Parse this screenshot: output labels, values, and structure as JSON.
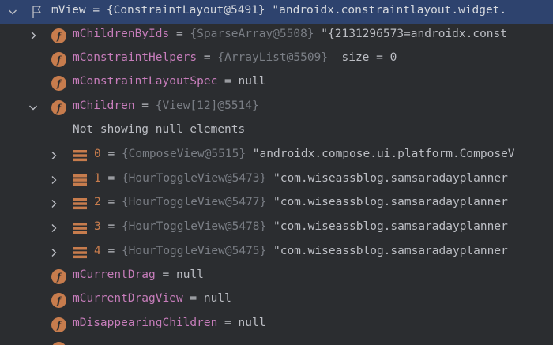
{
  "rows": [
    {
      "name": "mView",
      "eq": " = ",
      "ref": "{ConstraintLayout@5491}",
      "rest": " \"androidx.constraintlayout.widget."
    },
    {
      "name": "mChildrenByIds",
      "eq": " = ",
      "ref": "{SparseArray@5508}",
      "rest": " \"{2131296573=androidx.const"
    },
    {
      "name": "mConstraintHelpers",
      "eq": " = ",
      "ref": "{ArrayList@5509}",
      "rest": "  size = 0"
    },
    {
      "name": "mConstraintLayoutSpec",
      "eq": " = ",
      "rest": "null"
    },
    {
      "name": "mChildren",
      "eq": " = ",
      "ref": "{View[12]@5514}"
    },
    {
      "note": "Not showing null elements"
    },
    {
      "name": "0",
      "eq": " = ",
      "ref": "{ComposeView@5515}",
      "rest": " \"androidx.compose.ui.platform.ComposeV"
    },
    {
      "name": "1",
      "eq": " = ",
      "ref": "{HourToggleView@5473}",
      "rest": " \"com.wiseassblog.samsaradayplanner"
    },
    {
      "name": "2",
      "eq": " = ",
      "ref": "{HourToggleView@5477}",
      "rest": " \"com.wiseassblog.samsaradayplanner"
    },
    {
      "name": "3",
      "eq": " = ",
      "ref": "{HourToggleView@5478}",
      "rest": " \"com.wiseassblog.samsaradayplanner"
    },
    {
      "name": "4",
      "eq": " = ",
      "ref": "{HourToggleView@5475}",
      "rest": " \"com.wiseassblog.samsaradayplanner"
    },
    {
      "name": "mCurrentDrag",
      "eq": " = ",
      "rest": "null"
    },
    {
      "name": "mCurrentDragView",
      "eq": " = ",
      "rest": "null"
    },
    {
      "name": "mDisappearingChildren",
      "eq": " = ",
      "rest": "null"
    }
  ],
  "icons": {
    "field_letter": "f"
  },
  "colors": {
    "field_name": "#c77dbb",
    "field_icon": "#c77c4d",
    "ref": "#7a7e85",
    "selection": "#2e436e",
    "background": "#2b2d30"
  }
}
